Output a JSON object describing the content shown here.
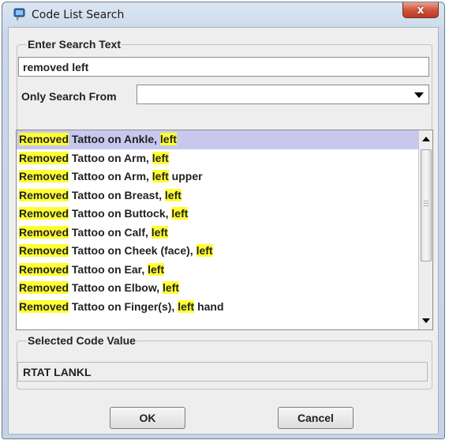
{
  "window": {
    "title": "Code List Search",
    "close_label": "x"
  },
  "search_group": {
    "legend": "Enter Search Text",
    "search_value": "removed left",
    "only_search_from_label": "Only Search From",
    "only_search_from_value": ""
  },
  "results": [
    {
      "prefix": "Removed",
      "middle": " Tattoo on Ankle, ",
      "match": "left",
      "suffix": ""
    },
    {
      "prefix": "Removed",
      "middle": " Tattoo on Arm, ",
      "match": "left",
      "suffix": ""
    },
    {
      "prefix": "Removed",
      "middle": " Tattoo on Arm, ",
      "match": "left",
      "suffix": " upper"
    },
    {
      "prefix": "Removed",
      "middle": " Tattoo on Breast, ",
      "match": "left",
      "suffix": ""
    },
    {
      "prefix": "Removed",
      "middle": " Tattoo on Buttock, ",
      "match": "left",
      "suffix": ""
    },
    {
      "prefix": "Removed",
      "middle": " Tattoo on Calf, ",
      "match": "left",
      "suffix": ""
    },
    {
      "prefix": "Removed",
      "middle": " Tattoo on Cheek (face), ",
      "match": "left",
      "suffix": ""
    },
    {
      "prefix": "Removed",
      "middle": " Tattoo on Ear, ",
      "match": "left",
      "suffix": ""
    },
    {
      "prefix": "Removed",
      "middle": " Tattoo on Elbow, ",
      "match": "left",
      "suffix": ""
    },
    {
      "prefix": "Removed",
      "middle": " Tattoo on Finger(s), ",
      "match": "left",
      "suffix": " hand"
    }
  ],
  "selected_group": {
    "legend": "Selected Code Value",
    "value": "RTAT LANKL"
  },
  "buttons": {
    "ok": "OK",
    "cancel": "Cancel"
  },
  "colors": {
    "highlight": "#ffff33",
    "selected_row": "#c8c8ef"
  }
}
